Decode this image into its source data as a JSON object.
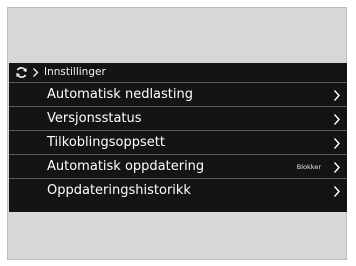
{
  "colors": {
    "panel_background": "#141414",
    "frame_background": "#d7d7d7",
    "text": "#ffffff",
    "divider": "#5a5a5a"
  },
  "header": {
    "icon": "refresh-icon",
    "separator_icon": "chevron-right-icon",
    "breadcrumb": "Innstillinger"
  },
  "menu": {
    "items": [
      {
        "label": "Automatisk nedlasting",
        "value": "",
        "icon": "chevron-right-icon"
      },
      {
        "label": "Versjonsstatus",
        "value": "",
        "icon": "chevron-right-icon"
      },
      {
        "label": "Tilkoblingsoppsett",
        "value": "",
        "icon": "chevron-right-icon"
      },
      {
        "label": "Automatisk oppdatering",
        "value": "Blokker",
        "icon": "chevron-right-icon"
      },
      {
        "label": "Oppdateringshistorikk",
        "value": "",
        "icon": "chevron-right-icon"
      }
    ]
  }
}
